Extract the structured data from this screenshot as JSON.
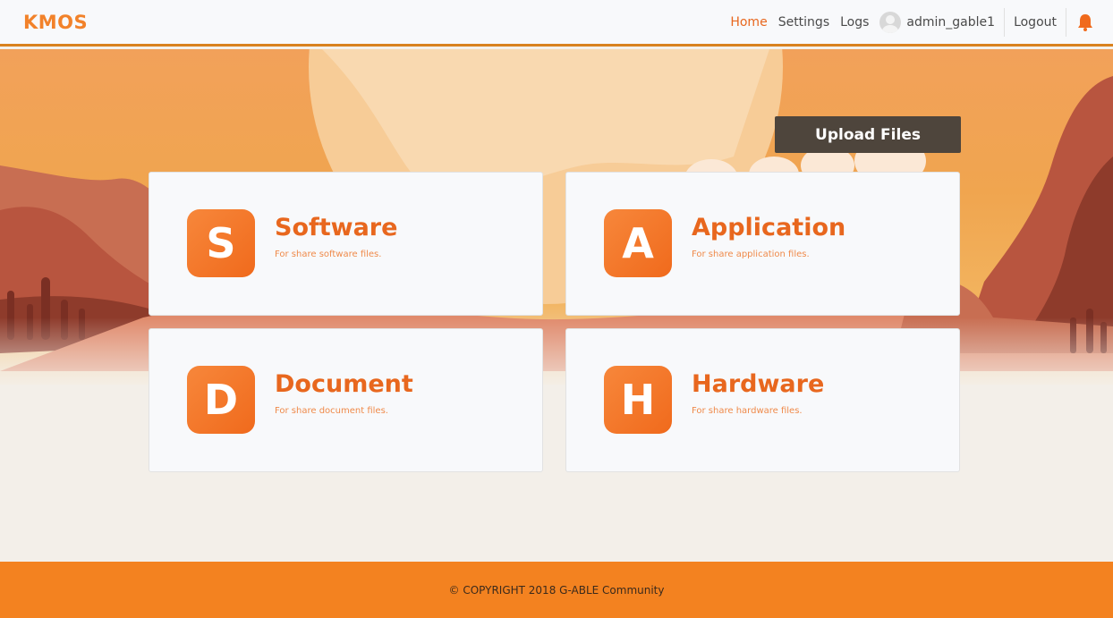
{
  "app": {
    "logo": "KMOS"
  },
  "nav": {
    "home": "Home",
    "settings": "Settings",
    "logs": "Logs",
    "username": "admin_gable1",
    "logout": "Logout"
  },
  "actions": {
    "upload_label": "Upload Files"
  },
  "cards": [
    {
      "letter": "S",
      "title": "Software",
      "desc": "For share software files."
    },
    {
      "letter": "A",
      "title": "Application",
      "desc": "For share application files."
    },
    {
      "letter": "D",
      "title": "Document",
      "desc": "For share document files."
    },
    {
      "letter": "H",
      "title": "Hardware",
      "desc": "For share hardware files."
    }
  ],
  "footer": {
    "copyright": "© COPYRIGHT 2018 G-ABLE Community"
  },
  "colors": {
    "accent": "#f38220",
    "active_nav": "#e8671e",
    "upload_button": "#4e453c",
    "card_background": "#f8f9fb"
  },
  "icons": [
    "user-avatar-icon",
    "bell-icon"
  ]
}
